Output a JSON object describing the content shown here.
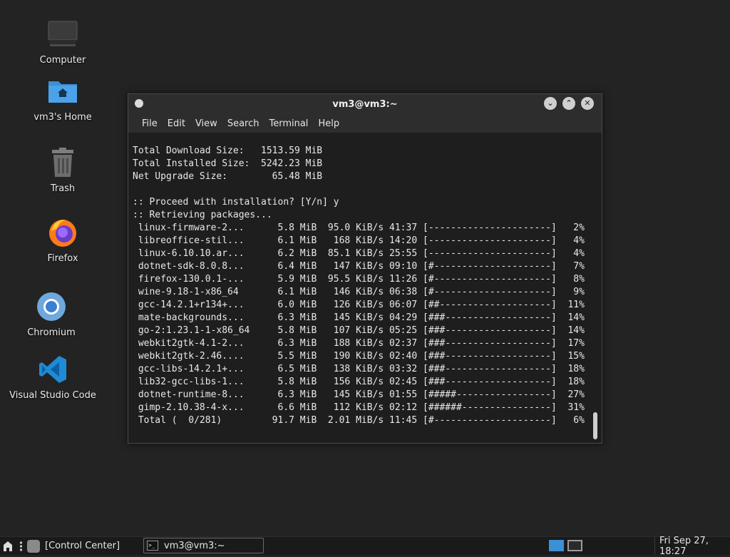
{
  "desktop": {
    "icons": [
      {
        "label": "Computer"
      },
      {
        "label": "vm3's Home"
      },
      {
        "label": "Trash"
      },
      {
        "label": "Firefox"
      },
      {
        "label": "Chromium"
      },
      {
        "label": "Visual Studio Code"
      }
    ]
  },
  "window": {
    "title": "vm3@vm3:~",
    "menu": [
      "File",
      "Edit",
      "View",
      "Search",
      "Terminal",
      "Help"
    ],
    "buttons": {
      "minimize": "⌄",
      "maximize": "⌃",
      "close": "✕"
    }
  },
  "terminal": {
    "lines": [
      "Total Download Size:   1513.59 MiB",
      "Total Installed Size:  5242.23 MiB",
      "Net Upgrade Size:        65.48 MiB",
      "",
      ":: Proceed with installation? [Y/n] y",
      ":: Retrieving packages...",
      " linux-firmware-2...      5.8 MiB  95.0 KiB/s 41:37 [----------------------]   2%",
      " libreoffice-stil...      6.1 MiB   168 KiB/s 14:20 [----------------------]   4%",
      " linux-6.10.10.ar...      6.2 MiB  85.1 KiB/s 25:55 [----------------------]   4%",
      " dotnet-sdk-8.0.8...      6.4 MiB   147 KiB/s 09:10 [#---------------------]   7%",
      " firefox-130.0.1-...      5.9 MiB  95.5 KiB/s 11:26 [#---------------------]   8%",
      " wine-9.18-1-x86_64       6.1 MiB   146 KiB/s 06:38 [#---------------------]   9%",
      " gcc-14.2.1+r134+...      6.0 MiB   126 KiB/s 06:07 [##--------------------]  11%",
      " mate-backgrounds...      6.3 MiB   145 KiB/s 04:29 [###-------------------]  14%",
      " go-2:1.23.1-1-x86_64     5.8 MiB   107 KiB/s 05:25 [###-------------------]  14%",
      " webkit2gtk-4.1-2...      6.3 MiB   188 KiB/s 02:37 [###-------------------]  17%",
      " webkit2gtk-2.46....      5.5 MiB   190 KiB/s 02:40 [###-------------------]  15%",
      " gcc-libs-14.2.1+...      6.5 MiB   138 KiB/s 03:32 [###-------------------]  18%",
      " lib32-gcc-libs-1...      5.8 MiB   156 KiB/s 02:45 [###-------------------]  18%",
      " dotnet-runtime-8...      6.3 MiB   145 KiB/s 01:55 [#####-----------------]  27%",
      " gimp-2.10.38-4-x...      6.6 MiB   112 KiB/s 02:12 [######----------------]  31%",
      " Total (  0/281)         91.7 MiB  2.01 MiB/s 11:45 [#---------------------]   6%"
    ]
  },
  "taskbar": {
    "control_center": "[Control Center]",
    "task_label": "vm3@vm3:~",
    "clock": "Fri Sep 27, 18:27"
  },
  "colors": {
    "desktop_bg": "#232323",
    "terminal_bg": "#1e1e1e",
    "folder_blue": "#3d8fd6",
    "workspace_active": "#3d8fd6"
  }
}
